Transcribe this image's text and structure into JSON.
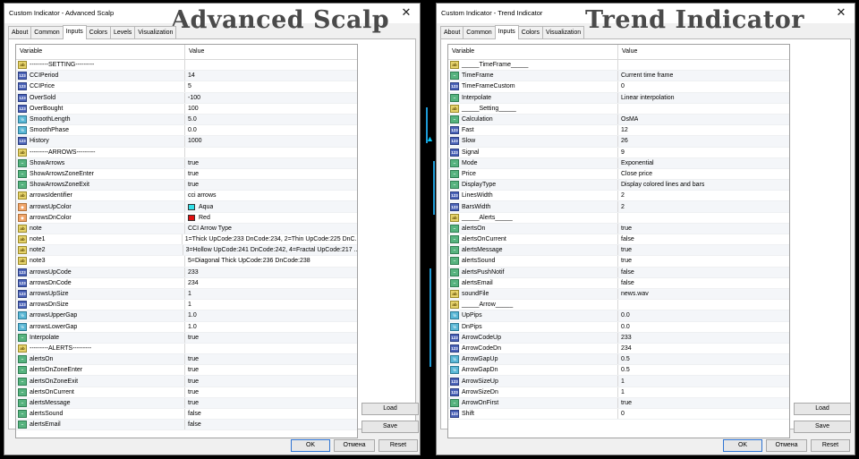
{
  "colors": {
    "aqua": "#33e0e8",
    "red": "#e01010"
  },
  "left": {
    "title": "Custom Indicator - Advanced Scalp",
    "banner": "Advanced Scalp",
    "close": "✕",
    "tabs": [
      "About",
      "Common",
      "Inputs",
      "Colors",
      "Levels",
      "Visualization"
    ],
    "active_tab": "Inputs",
    "header": {
      "variable": "Variable",
      "value": "Value"
    },
    "rows": [
      {
        "icon": "ab",
        "name": "---------SETTING---------",
        "value": ""
      },
      {
        "icon": "123",
        "name": "CCIPeriod",
        "value": "14"
      },
      {
        "icon": "123",
        "name": "CCIPrice",
        "value": "5"
      },
      {
        "icon": "123",
        "name": "OverSold",
        "value": "-100"
      },
      {
        "icon": "123",
        "name": "OverBought",
        "value": "100"
      },
      {
        "icon": "v12",
        "name": "SmoothLength",
        "value": "5.0"
      },
      {
        "icon": "v12",
        "name": "SmoothPhase",
        "value": "0.0"
      },
      {
        "icon": "123",
        "name": "History",
        "value": "1000"
      },
      {
        "icon": "ab",
        "name": "---------ARROWS---------",
        "value": ""
      },
      {
        "icon": "enum",
        "name": "ShowArrows",
        "value": "true"
      },
      {
        "icon": "enum",
        "name": "ShowArrowsZoneEnter",
        "value": "true"
      },
      {
        "icon": "enum",
        "name": "ShowArrowsZoneExit",
        "value": "true"
      },
      {
        "icon": "ab",
        "name": "arrowsIdentifier",
        "value": "cci arrows"
      },
      {
        "icon": "color",
        "name": "arrowsUpColor",
        "value": "Aqua",
        "swatch": "aqua"
      },
      {
        "icon": "color",
        "name": "arrowsDnColor",
        "value": "Red",
        "swatch": "red"
      },
      {
        "icon": "ab",
        "name": "note",
        "value": "CCI Arrow Type"
      },
      {
        "icon": "ab",
        "name": "note1",
        "value": "1=Thick UpCode:233 DnCode:234, 2=Thin UpCode:225 DnC..."
      },
      {
        "icon": "ab",
        "name": "note2",
        "value": "3=Hollow UpCode:241 DnCode:242, 4=Fractal UpCode:217 ..."
      },
      {
        "icon": "ab",
        "name": "note3",
        "value": "5=Diagonal Thick UpCode:236 DnCode:238"
      },
      {
        "icon": "123",
        "name": "arrowsUpCode",
        "value": "233"
      },
      {
        "icon": "123",
        "name": "arrowsDnCode",
        "value": "234"
      },
      {
        "icon": "123",
        "name": "arrowsUpSize",
        "value": "1"
      },
      {
        "icon": "123",
        "name": "arrowsDnSize",
        "value": "1"
      },
      {
        "icon": "v12",
        "name": "arrowsUpperGap",
        "value": "1.0"
      },
      {
        "icon": "v12",
        "name": "arrowsLowerGap",
        "value": "1.0"
      },
      {
        "icon": "enum",
        "name": "Interpolate",
        "value": "true"
      },
      {
        "icon": "ab",
        "name": "---------ALERTS---------",
        "value": ""
      },
      {
        "icon": "enum",
        "name": "alertsOn",
        "value": "true"
      },
      {
        "icon": "enum",
        "name": "alertsOnZoneEnter",
        "value": "true"
      },
      {
        "icon": "enum",
        "name": "alertsOnZoneExit",
        "value": "true"
      },
      {
        "icon": "enum",
        "name": "alertsOnCurrent",
        "value": "true"
      },
      {
        "icon": "enum",
        "name": "alertsMessage",
        "value": "true"
      },
      {
        "icon": "enum",
        "name": "alertsSound",
        "value": "false"
      },
      {
        "icon": "enum",
        "name": "alertsEmail",
        "value": "false"
      }
    ],
    "buttons": {
      "load": "Load",
      "save": "Save",
      "ok": "OK",
      "cancel": "Отмена",
      "reset": "Reset"
    }
  },
  "right": {
    "title": "Custom Indicator - Trend Indicator",
    "banner": "Trend Indicator",
    "close": "✕",
    "tabs": [
      "About",
      "Common",
      "Inputs",
      "Colors",
      "Visualization"
    ],
    "active_tab": "Inputs",
    "header": {
      "variable": "Variable",
      "value": "Value"
    },
    "rows": [
      {
        "icon": "ab",
        "name": "_____TimeFrame_____",
        "value": ""
      },
      {
        "icon": "enum",
        "name": "TimeFrame",
        "value": "Current time frame"
      },
      {
        "icon": "123",
        "name": "TimeFrameCustom",
        "value": "0"
      },
      {
        "icon": "enum",
        "name": "Interpolate",
        "value": "Linear interpolation"
      },
      {
        "icon": "ab",
        "name": "_____Setting_____",
        "value": ""
      },
      {
        "icon": "enum",
        "name": "Calculation",
        "value": "OsMA"
      },
      {
        "icon": "123",
        "name": "Fast",
        "value": "12"
      },
      {
        "icon": "123",
        "name": "Slow",
        "value": "26"
      },
      {
        "icon": "123",
        "name": "Signal",
        "value": "9"
      },
      {
        "icon": "enum",
        "name": "Mode",
        "value": "Exponential"
      },
      {
        "icon": "enum",
        "name": "Price",
        "value": "Close price"
      },
      {
        "icon": "enum",
        "name": "DisplayType",
        "value": "Display colored lines and bars"
      },
      {
        "icon": "123",
        "name": "LinesWidth",
        "value": "2"
      },
      {
        "icon": "123",
        "name": "BarsWidth",
        "value": "2"
      },
      {
        "icon": "ab",
        "name": "_____Alerts_____",
        "value": ""
      },
      {
        "icon": "enum",
        "name": "alertsOn",
        "value": "true"
      },
      {
        "icon": "enum",
        "name": "alertsOnCurrent",
        "value": "false"
      },
      {
        "icon": "enum",
        "name": "alertsMessage",
        "value": "true"
      },
      {
        "icon": "enum",
        "name": "alertsSound",
        "value": "true"
      },
      {
        "icon": "enum",
        "name": "alertsPushNotif",
        "value": "false"
      },
      {
        "icon": "enum",
        "name": "alertsEmail",
        "value": "false"
      },
      {
        "icon": "ab",
        "name": "soundFile",
        "value": "news.wav"
      },
      {
        "icon": "ab",
        "name": "_____Arrow_____",
        "value": ""
      },
      {
        "icon": "v12",
        "name": "UpPips",
        "value": "0.0"
      },
      {
        "icon": "v12",
        "name": "DnPips",
        "value": "0.0"
      },
      {
        "icon": "123",
        "name": "ArrowCodeUp",
        "value": "233"
      },
      {
        "icon": "123",
        "name": "ArrowCodeDn",
        "value": "234"
      },
      {
        "icon": "v12",
        "name": "ArrowGapUp",
        "value": "0.5"
      },
      {
        "icon": "v12",
        "name": "ArrowGapDn",
        "value": "0.5"
      },
      {
        "icon": "123",
        "name": "ArrowSizeUp",
        "value": "1"
      },
      {
        "icon": "123",
        "name": "ArrowSizeDn",
        "value": "1"
      },
      {
        "icon": "enum",
        "name": "ArrowOnFirst",
        "value": "true"
      },
      {
        "icon": "123",
        "name": "Shift",
        "value": "0"
      }
    ],
    "buttons": {
      "load": "Load",
      "save": "Save",
      "ok": "OK",
      "cancel": "Отмена",
      "reset": "Reset"
    }
  }
}
